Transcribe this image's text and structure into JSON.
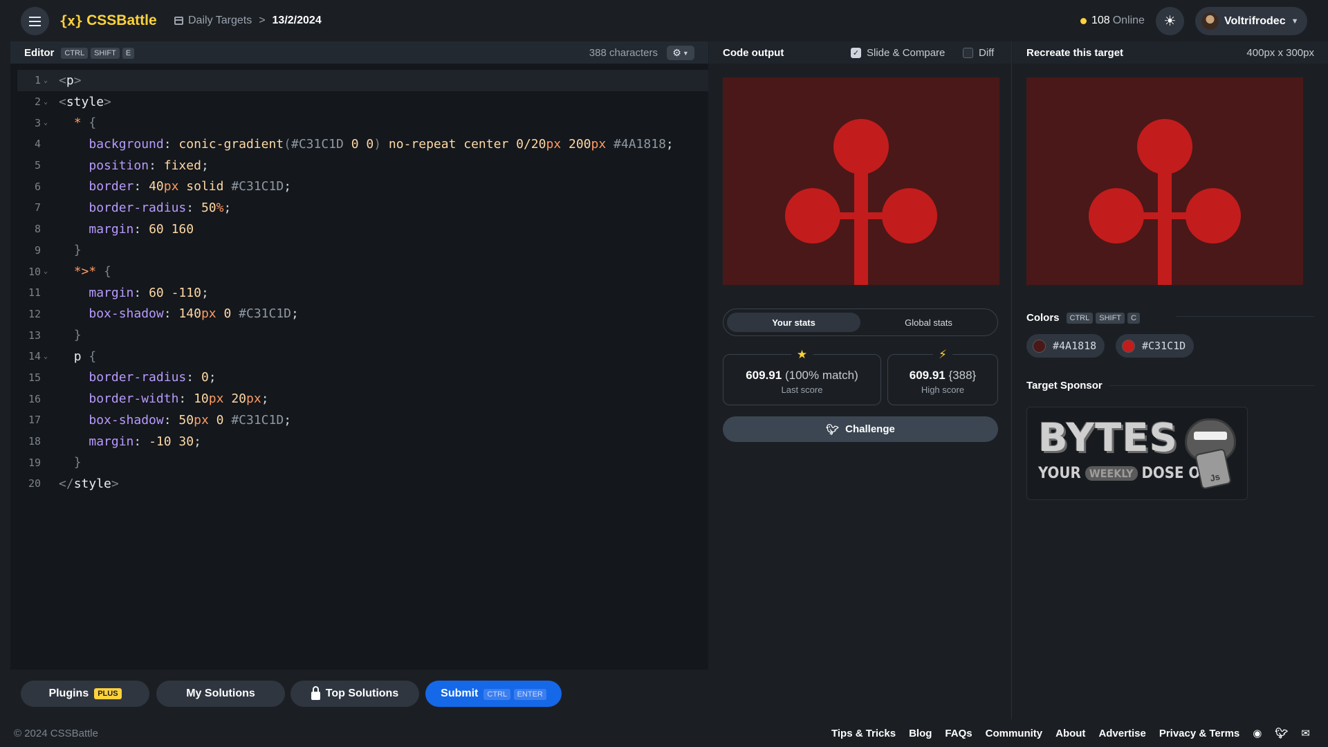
{
  "header": {
    "logo_mark": "{x}",
    "logo_text": "CSSBattle",
    "breadcrumb_link": "Daily Targets",
    "breadcrumb_separator": ">",
    "breadcrumb_current": "13/2/2024",
    "online_count": "108",
    "online_label": "Online",
    "user_name": "Voltrifrodec"
  },
  "editor": {
    "title": "Editor",
    "shortcut": [
      "CTRL",
      "SHIFT",
      "E"
    ],
    "char_count": "388 characters"
  },
  "code_lines": [
    [
      "1",
      true
    ],
    [
      "2",
      true
    ],
    [
      "3",
      true
    ],
    [
      "4",
      false
    ],
    [
      "5",
      false
    ],
    [
      "6",
      false
    ],
    [
      "7",
      false
    ],
    [
      "8",
      false
    ],
    [
      "9",
      false
    ],
    [
      "10",
      true
    ],
    [
      "11",
      false
    ],
    [
      "12",
      false
    ],
    [
      "13",
      false
    ],
    [
      "14",
      true
    ],
    [
      "15",
      false
    ],
    [
      "16",
      false
    ],
    [
      "17",
      false
    ],
    [
      "18",
      false
    ],
    [
      "19",
      false
    ],
    [
      "20",
      false
    ]
  ],
  "buttons": {
    "plugins": "Plugins",
    "plugins_badge": "PLUS",
    "my_solutions": "My Solutions",
    "top_solutions": "Top Solutions",
    "submit": "Submit",
    "submit_shortcut": [
      "CTRL",
      "ENTER"
    ],
    "challenge": "Challenge"
  },
  "output": {
    "title": "Code output",
    "slide_compare": "Slide & Compare",
    "slide_compare_checked": true,
    "diff": "Diff",
    "diff_checked": false,
    "stats_tabs": [
      "Your stats",
      "Global stats"
    ],
    "last_score_value": "609.91",
    "last_score_detail": "(100% match)",
    "last_score_label": "Last score",
    "high_score_value": "609.91",
    "high_score_detail": "{388}",
    "high_score_label": "High score"
  },
  "target": {
    "title": "Recreate this target",
    "size": "400px x 300px",
    "colors_title": "Colors",
    "colors_shortcut": [
      "CTRL",
      "SHIFT",
      "C"
    ],
    "colors": [
      "#4A1818",
      "#C31C1D"
    ],
    "sponsor_title": "Target Sponsor",
    "sponsor_word": "BYTES",
    "sponsor_your": "YOUR",
    "sponsor_weekly": "WEEKLY",
    "sponsor_dose": "DOSE OF",
    "sponsor_js": "Js"
  },
  "footer": {
    "copyright": "© 2024 CSSBattle",
    "links": [
      "Tips & Tricks",
      "Blog",
      "FAQs",
      "Community",
      "About",
      "Advertise",
      "Privacy & Terms"
    ]
  },
  "colors": {
    "accent": "#ffd23b",
    "submit_blue": "#1568e8",
    "canvas_bg": "#4A1818",
    "canvas_fg": "#C31C1D"
  }
}
